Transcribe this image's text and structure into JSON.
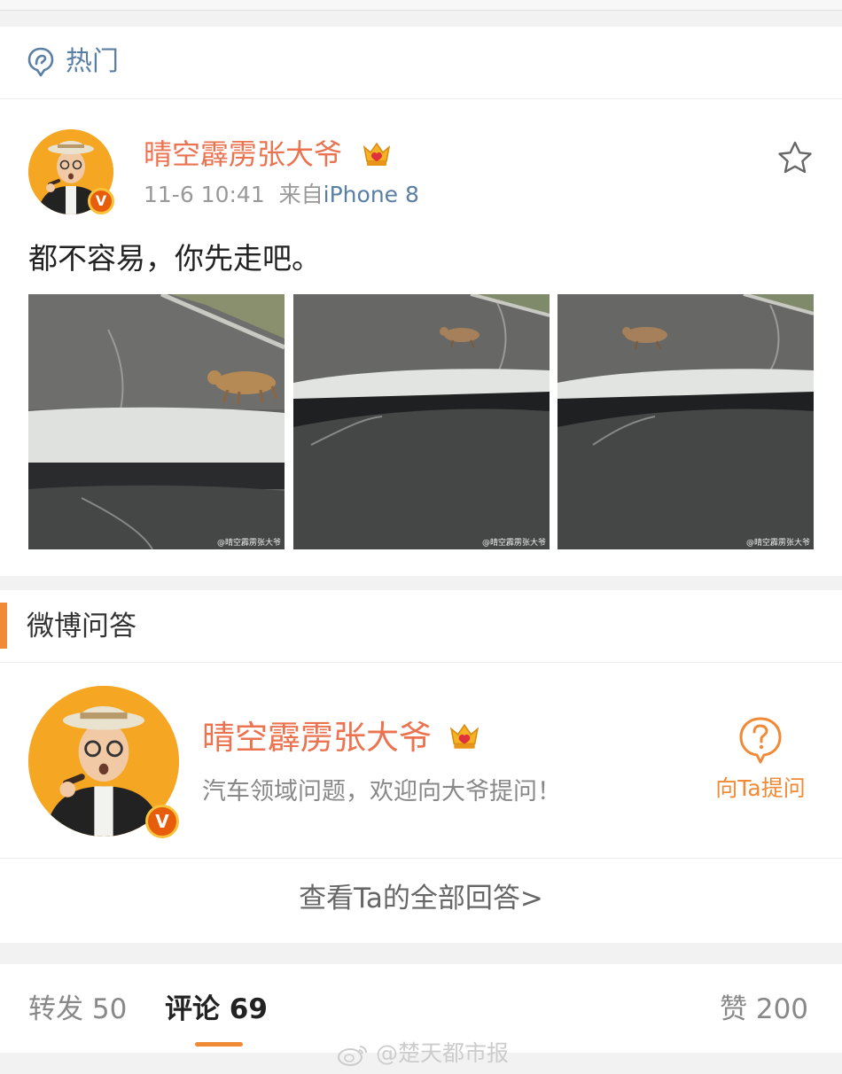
{
  "hot": {
    "label": "热门"
  },
  "post": {
    "author": "晴空霹雳张大爷",
    "time": "11-6 10:41",
    "source_prefix": "来自",
    "source": "iPhone 8",
    "text": "都不容易，你先走吧。",
    "images": [
      {
        "watermark": "@晴空霹雳张大爷"
      },
      {
        "watermark": "@晴空霹雳张大爷"
      },
      {
        "watermark": "@晴空霹雳张大爷"
      }
    ]
  },
  "qa": {
    "section_title": "微博问答",
    "name": "晴空霹雳张大爷",
    "description": "汽车领域问题，欢迎向大爷提问！",
    "ask_label": "向Ta提问",
    "all_answers": "查看Ta的全部回答>"
  },
  "tabs": {
    "repost_label": "转发",
    "repost_count": "50",
    "comment_label": "评论",
    "comment_count": "69",
    "like_label": "赞",
    "like_count": "200"
  },
  "watermark": "@楚天都市报",
  "colors": {
    "name": "#eb7350",
    "link": "#5a7fa5",
    "accent": "#f08a36"
  }
}
